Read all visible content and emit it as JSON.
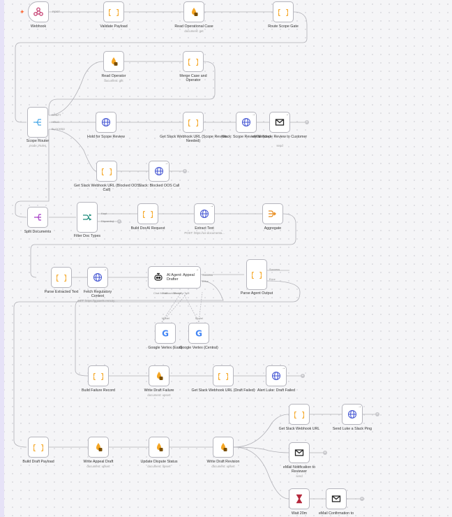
{
  "canvas": {
    "accent": "#ff6d3a",
    "node_border": "#b5b5bd",
    "edge_color": "#b0b0b6"
  },
  "trigger_icon": "lightning-bolt-icon",
  "nodes": [
    {
      "id": "webhook",
      "label": "Webhook",
      "icon": "webhook-icon",
      "ports": [
        "POST"
      ]
    },
    {
      "id": "validate",
      "label": "Validate Payload",
      "icon": "code-braces-icon"
    },
    {
      "id": "read_case",
      "label": "Read Operational Case",
      "sub": "document: get",
      "icon": "database-icon"
    },
    {
      "id": "route_gate",
      "label": "Route Scope Gate",
      "icon": "code-braces-icon"
    },
    {
      "id": "read_operator",
      "label": "Read Operator",
      "sub": "document: get",
      "icon": "database-icon"
    },
    {
      "id": "merge_case",
      "label": "Merge Case and Operator",
      "icon": "code-braces-icon"
    },
    {
      "id": "scope_router",
      "label": "Scope Router",
      "sub": "mode: Rules",
      "icon": "router-icon",
      "ports": [
        "DRAFT",
        "HOLD",
        "BLOCKED"
      ]
    },
    {
      "id": "hold_review",
      "label": "Hold for Scope Review",
      "icon": "globe-icon"
    },
    {
      "id": "get_slack_scope",
      "label": "Get Slack Webhook URL (Scope Review Needed)",
      "icon": "code-braces-icon"
    },
    {
      "id": "slack_scope",
      "label": "Slack: Scope Review Needed",
      "icon": "globe-icon"
    },
    {
      "id": "email_scope",
      "label": "eMail Scope Review to Customer",
      "sub": "send",
      "icon": "envelope-icon"
    },
    {
      "id": "get_slack_blocked",
      "label": "Get Slack Webhook URL (Blocked OOS Call)",
      "icon": "code-braces-icon"
    },
    {
      "id": "slack_blocked",
      "label": "Slack: Blocked OOS Call",
      "icon": "globe-icon"
    },
    {
      "id": "split_docs",
      "label": "Split Documents",
      "icon": "split-icon"
    },
    {
      "id": "filter_docs",
      "label": "Filter Doc Types",
      "icon": "filter-icon",
      "ports": [
        "Kept",
        "Discarded"
      ]
    },
    {
      "id": "build_docai",
      "label": "Build DocAI Request",
      "icon": "code-braces-icon"
    },
    {
      "id": "extract_text",
      "label": "Extract Text",
      "sub": "POST: https://us-documenta...",
      "icon": "globe-icon"
    },
    {
      "id": "aggregate",
      "label": "Aggregate",
      "icon": "aggregate-icon"
    },
    {
      "id": "parse_extracted",
      "label": "Parse Extracted Text",
      "icon": "code-braces-icon"
    },
    {
      "id": "fetch_reg",
      "label": "Fetch Regulatory Context",
      "sub": "GET: https://ggoaels.remoty....",
      "icon": "globe-icon"
    },
    {
      "id": "ai_agent",
      "label": "AI Agent: Appeal Drafter",
      "icon": "robot-icon",
      "ports": [
        "Success",
        "Error",
        "Chat Model",
        "Fallback Model",
        "Memory",
        "Tool"
      ]
    },
    {
      "id": "parse_agent",
      "label": "Parse Agent Output",
      "icon": "code-braces-icon",
      "ports": [
        "Success",
        "Error"
      ]
    },
    {
      "id": "vertex_east",
      "label": "Google Vertex (East)",
      "icon": "google-icon",
      "ports": [
        "Model"
      ]
    },
    {
      "id": "vertex_central",
      "label": "Google Vertex (Central)",
      "icon": "google-icon",
      "ports": [
        "Model"
      ]
    },
    {
      "id": "build_failure",
      "label": "Build Failure Record",
      "icon": "code-braces-icon"
    },
    {
      "id": "write_failure",
      "label": "Write Draft Failure",
      "sub": "document: upsert",
      "icon": "database-icon"
    },
    {
      "id": "get_slack_failed",
      "label": "Get Slack Webhook URL (Draft Failed)",
      "icon": "code-braces-icon"
    },
    {
      "id": "alert_luke",
      "label": "Alert Luke: Draft Failed",
      "icon": "globe-icon"
    },
    {
      "id": "get_slack_url",
      "label": "Get Slack Webhook URL",
      "icon": "code-braces-icon"
    },
    {
      "id": "send_luke",
      "label": "Send Luke a Slack Ping",
      "icon": "globe-icon"
    },
    {
      "id": "build_payload",
      "label": "Build Draft Payload",
      "icon": "code-braces-icon"
    },
    {
      "id": "write_appeal",
      "label": "Write Appeal Draft",
      "sub": "document: upsert",
      "icon": "database-icon"
    },
    {
      "id": "update_dispute",
      "label": "Update Dispute Status",
      "sub": "document: upsert",
      "icon": "database-icon"
    },
    {
      "id": "write_revision",
      "label": "Write Draft Revision",
      "sub": "document: upsert",
      "icon": "database-icon"
    },
    {
      "id": "email_reviewer",
      "label": "eMail Notification to Reviewer",
      "sub": "send",
      "icon": "envelope-icon"
    },
    {
      "id": "wait",
      "label": "Wait 20m",
      "icon": "hourglass-icon"
    },
    {
      "id": "email_confirm",
      "label": "eMail Confirmation to",
      "icon": "envelope-icon"
    }
  ]
}
